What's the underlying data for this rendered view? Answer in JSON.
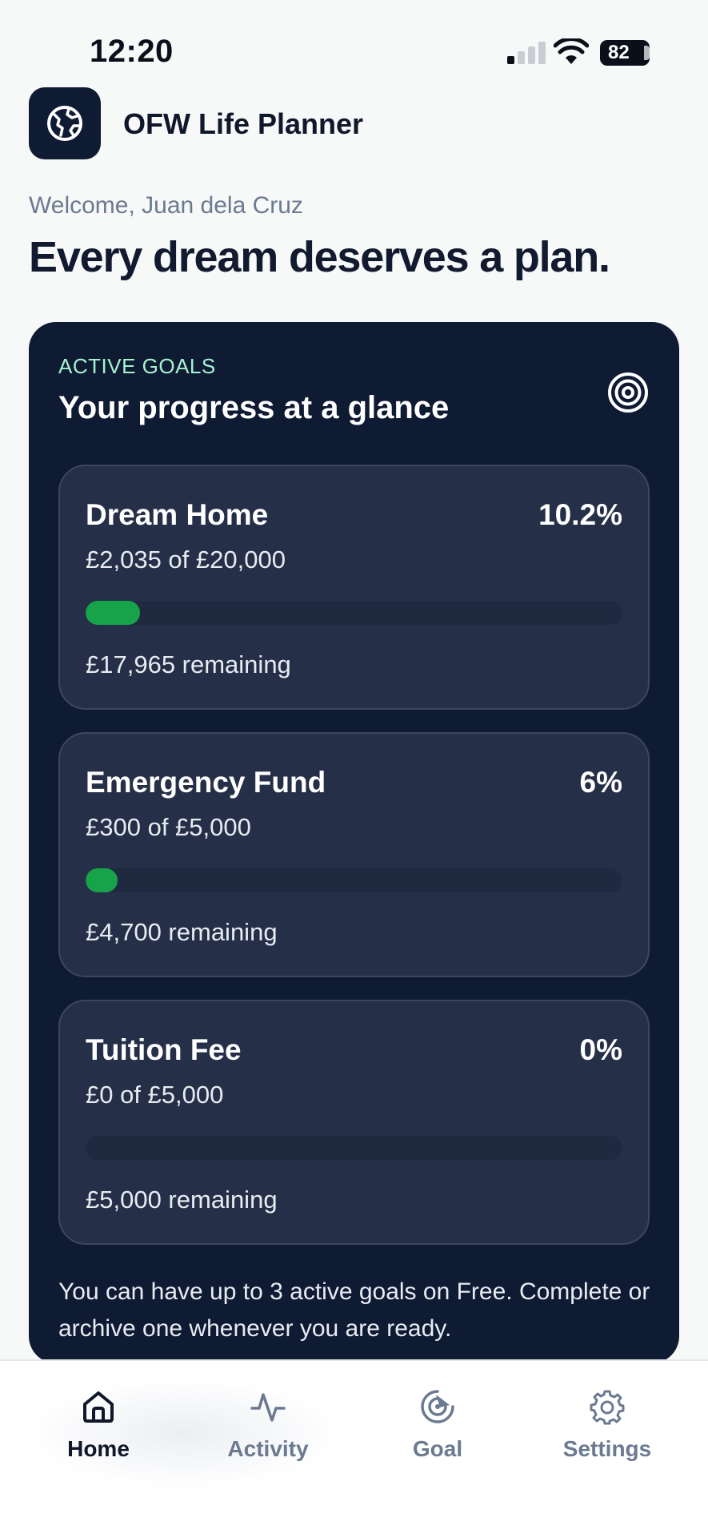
{
  "status_bar": {
    "time": "12:20",
    "battery": "82"
  },
  "app": {
    "title": "OFW Life Planner"
  },
  "welcome": "Welcome, Juan dela Cruz",
  "headline": "Every dream deserves a plan.",
  "goals_section": {
    "eyebrow": "ACTIVE GOALS",
    "title": "Your progress at a glance",
    "goals": [
      {
        "name": "Dream Home",
        "percent": "10.2%",
        "progress": 0.102,
        "amount": "£2,035 of £20,000",
        "remaining": "£17,965 remaining"
      },
      {
        "name": "Emergency Fund",
        "percent": "6%",
        "progress": 0.06,
        "amount": "£300 of £5,000",
        "remaining": "£4,700 remaining"
      },
      {
        "name": "Tuition Fee",
        "percent": "0%",
        "progress": 0,
        "amount": "£0 of £5,000",
        "remaining": "£5,000 remaining"
      }
    ],
    "note": "You can have up to 3 active goals on Free. Complete or archive one whenever you are ready."
  },
  "nav": {
    "items": [
      {
        "label": "Home",
        "icon": "home-icon",
        "active": true
      },
      {
        "label": "Activity",
        "icon": "activity-icon",
        "active": false
      },
      {
        "label": "Goal",
        "icon": "goal-icon",
        "active": false
      },
      {
        "label": "Settings",
        "icon": "settings-icon",
        "active": false
      }
    ]
  },
  "colors": {
    "card_bg": "#0f1a33",
    "progress_fill": "#16a34a",
    "eyebrow": "#a7f3d0"
  }
}
